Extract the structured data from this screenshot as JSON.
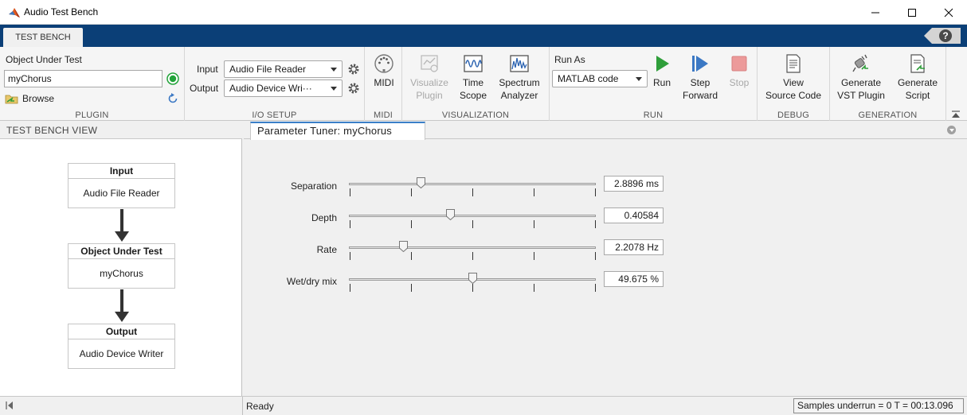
{
  "window": {
    "title": "Audio Test Bench"
  },
  "ribbon": {
    "active_tab": "TEST BENCH",
    "help_label": "?"
  },
  "plugin": {
    "object_label": "Object Under Test",
    "object_value": "myChorus",
    "browse_label": "Browse",
    "section_label": "PLUGIN"
  },
  "io_setup": {
    "input_label": "Input",
    "input_value": "Audio File Reader",
    "output_label": "Output",
    "output_value": "Audio Device Wri···",
    "section_label": "I/O SETUP"
  },
  "midi": {
    "button_label": "MIDI",
    "section_label": "MIDI"
  },
  "visualization": {
    "visualize_label_1": "Visualize",
    "visualize_label_2": "Plugin",
    "time_scope_label_1": "Time",
    "time_scope_label_2": "Scope",
    "spectrum_label_1": "Spectrum",
    "spectrum_label_2": "Analyzer",
    "section_label": "VISUALIZATION"
  },
  "run": {
    "run_as_label": "Run As",
    "run_as_value": "MATLAB code",
    "run_label": "Run",
    "step_label_1": "Step",
    "step_label_2": "Forward",
    "stop_label": "Stop",
    "section_label": "RUN"
  },
  "debug": {
    "view_label_1": "View",
    "view_label_2": "Source Code",
    "section_label": "DEBUG"
  },
  "generation": {
    "vst_label_1": "Generate",
    "vst_label_2": "VST Plugin",
    "script_label_1": "Generate",
    "script_label_2": "Script",
    "section_label": "GENERATION"
  },
  "test_bench_view": {
    "header": "TEST BENCH VIEW",
    "blocks": [
      {
        "title": "Input",
        "content": "Audio File Reader"
      },
      {
        "title": "Object Under Test",
        "content": "myChorus"
      },
      {
        "title": "Output",
        "content": "Audio Device Writer"
      }
    ]
  },
  "parameter_tuner": {
    "tab_label": "Parameter Tuner: myChorus",
    "params": [
      {
        "name": "Separation",
        "value": "2.8896 ms",
        "position": 0.29
      },
      {
        "name": "Depth",
        "value": "0.40584",
        "position": 0.41
      },
      {
        "name": "Rate",
        "value": "2.2078 Hz",
        "position": 0.22
      },
      {
        "name": "Wet/dry mix",
        "value": "49.675 %",
        "position": 0.5
      }
    ]
  },
  "status": {
    "left_text": "Ready",
    "right_text": "Samples underrun = 0     T = 00:13.096"
  },
  "colors": {
    "ribbon_blue": "#0b3f77",
    "run_green": "#2f9e3a",
    "step_blue": "#3b78c4",
    "status_ok_green": "#22a33a"
  }
}
